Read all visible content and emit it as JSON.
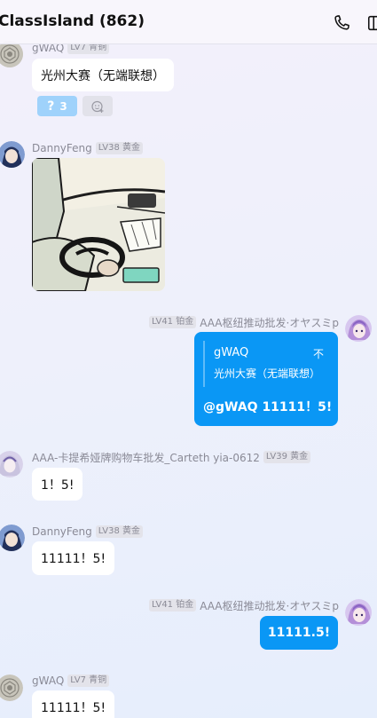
{
  "header": {
    "title": "ClassIsland (862)"
  },
  "messages": [
    {
      "sender": "gWAQ",
      "badge": "LV7 青铜",
      "text": "光州大赛（无端联想）",
      "reaction_count": "3"
    },
    {
      "sender": "DannyFeng",
      "badge": "LV38 黄金",
      "image": "sticker-car-driving"
    },
    {
      "sender": "AAA枢纽推动批发·オヤスミp",
      "badge": "LV41 铂金",
      "quote_name": "gWAQ",
      "quote_mark": "不",
      "quote_text": "光州大赛（无端联想）",
      "text": "@gWAQ 11111！5!"
    },
    {
      "sender": "AAA-卡提希娅牌购物车批发_Carteth yia-0612",
      "sender_display": "AAA-卡提希娅牌购物车批发_Carteth yia-0612",
      "badge": "LV39 黄金",
      "text": "1！5!"
    },
    {
      "sender": "DannyFeng",
      "badge": "LV38 黄金",
      "text": "11111！5!"
    },
    {
      "sender": "AAA枢纽推动批发·オヤスミp",
      "badge": "LV41 铂金",
      "text": "11111.5!"
    },
    {
      "sender": "gWAQ",
      "badge": "LV7 青铜",
      "text": "11111！5!"
    }
  ],
  "colors": {
    "accent": "#0a97f5",
    "bubble": "#ffffff",
    "reaction_bg": "#9fd2fb"
  },
  "icons": [
    "phone-icon",
    "more-icon",
    "add-reaction-icon",
    "question-mark-icon"
  ]
}
